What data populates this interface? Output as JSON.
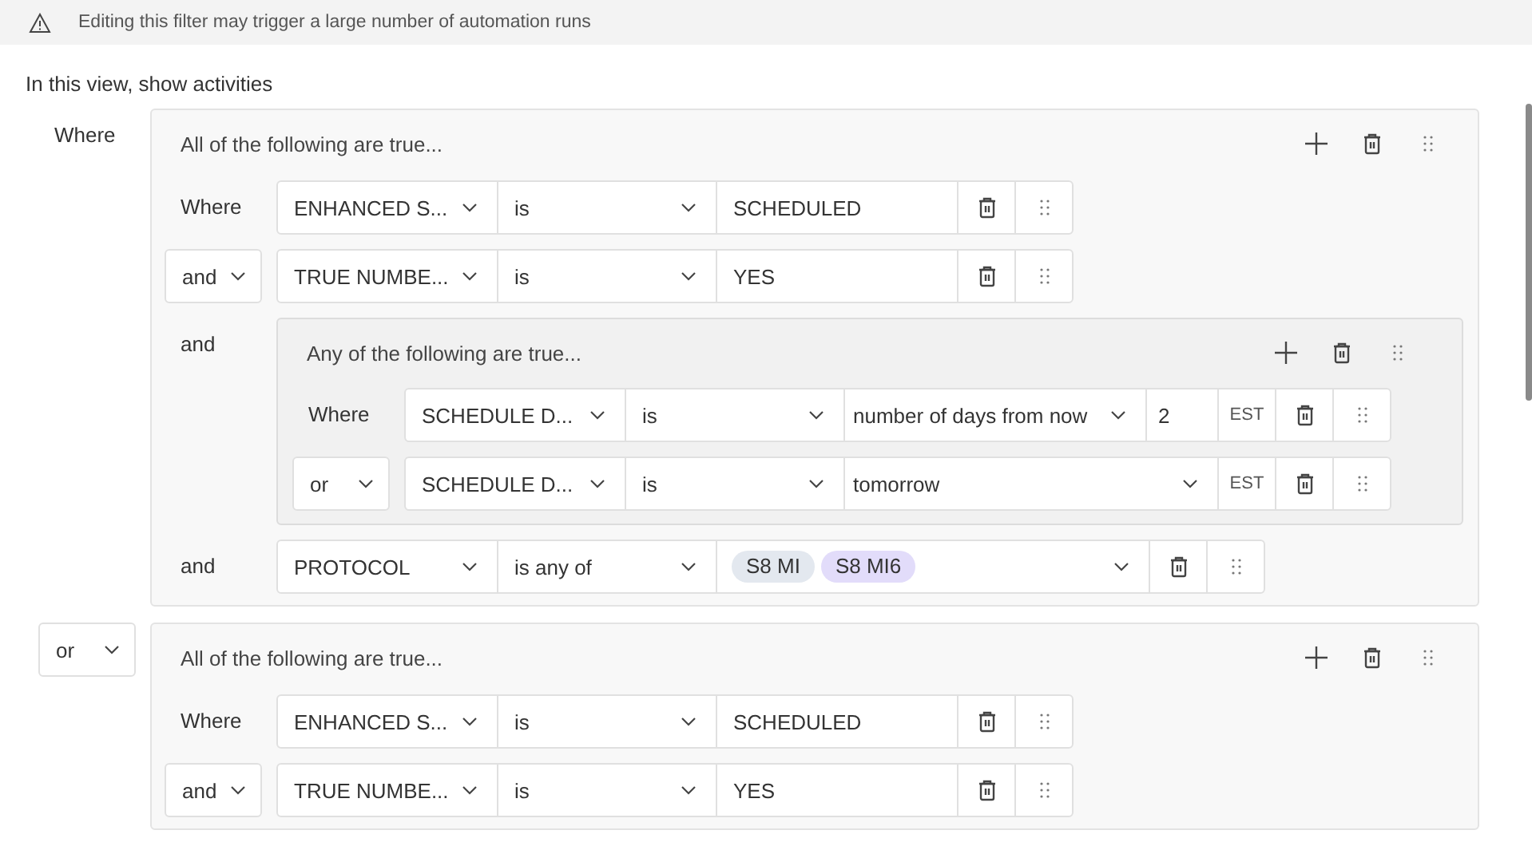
{
  "banner": {
    "text": "Editing this filter may trigger a large number of automation runs"
  },
  "heading": "In this view, show activities",
  "groups": [
    {
      "conjunction": {
        "kind": "label",
        "text": "Where"
      },
      "title": "All of the following are true...",
      "items": [
        {
          "kind": "condition",
          "conjunction": {
            "kind": "label",
            "text": "Where"
          },
          "field": "ENHANCED S...",
          "operator": "is",
          "value": {
            "kind": "text",
            "text": "SCHEDULED"
          }
        },
        {
          "kind": "condition",
          "conjunction": {
            "kind": "select",
            "text": "and"
          },
          "field": "TRUE NUMBE...",
          "operator": "is",
          "value": {
            "kind": "text",
            "text": "YES"
          }
        },
        {
          "kind": "group",
          "conjunction": {
            "kind": "label",
            "text": "and"
          },
          "title": "Any of the following are true...",
          "items": [
            {
              "kind": "condition",
              "conjunction": {
                "kind": "label",
                "text": "Where"
              },
              "field": "SCHEDULE D...",
              "operator": "is",
              "value": {
                "kind": "select",
                "text": "number of days from now"
              },
              "amount": "2",
              "timezone": "EST"
            },
            {
              "kind": "condition",
              "conjunction": {
                "kind": "select",
                "text": "or"
              },
              "field": "SCHEDULE D...",
              "operator": "is",
              "value": {
                "kind": "select",
                "text": "tomorrow"
              },
              "timezone": "EST"
            }
          ]
        },
        {
          "kind": "condition",
          "conjunction": {
            "kind": "label",
            "text": "and"
          },
          "field": "PROTOCOL",
          "operator": "is any of",
          "value": {
            "kind": "tags",
            "tags": [
              {
                "text": "S8 MI",
                "color": "#e3e8ef"
              },
              {
                "text": "S8 MI6",
                "color": "#e2dcfa"
              }
            ]
          }
        }
      ]
    },
    {
      "conjunction": {
        "kind": "select",
        "text": "or"
      },
      "title": "All of the following are true...",
      "items": [
        {
          "kind": "condition",
          "conjunction": {
            "kind": "label",
            "text": "Where"
          },
          "field": "ENHANCED S...",
          "operator": "is",
          "value": {
            "kind": "text",
            "text": "SCHEDULED"
          }
        },
        {
          "kind": "condition",
          "conjunction": {
            "kind": "select",
            "text": "and"
          },
          "field": "TRUE NUMBE...",
          "operator": "is",
          "value": {
            "kind": "text",
            "text": "YES"
          }
        }
      ]
    }
  ]
}
